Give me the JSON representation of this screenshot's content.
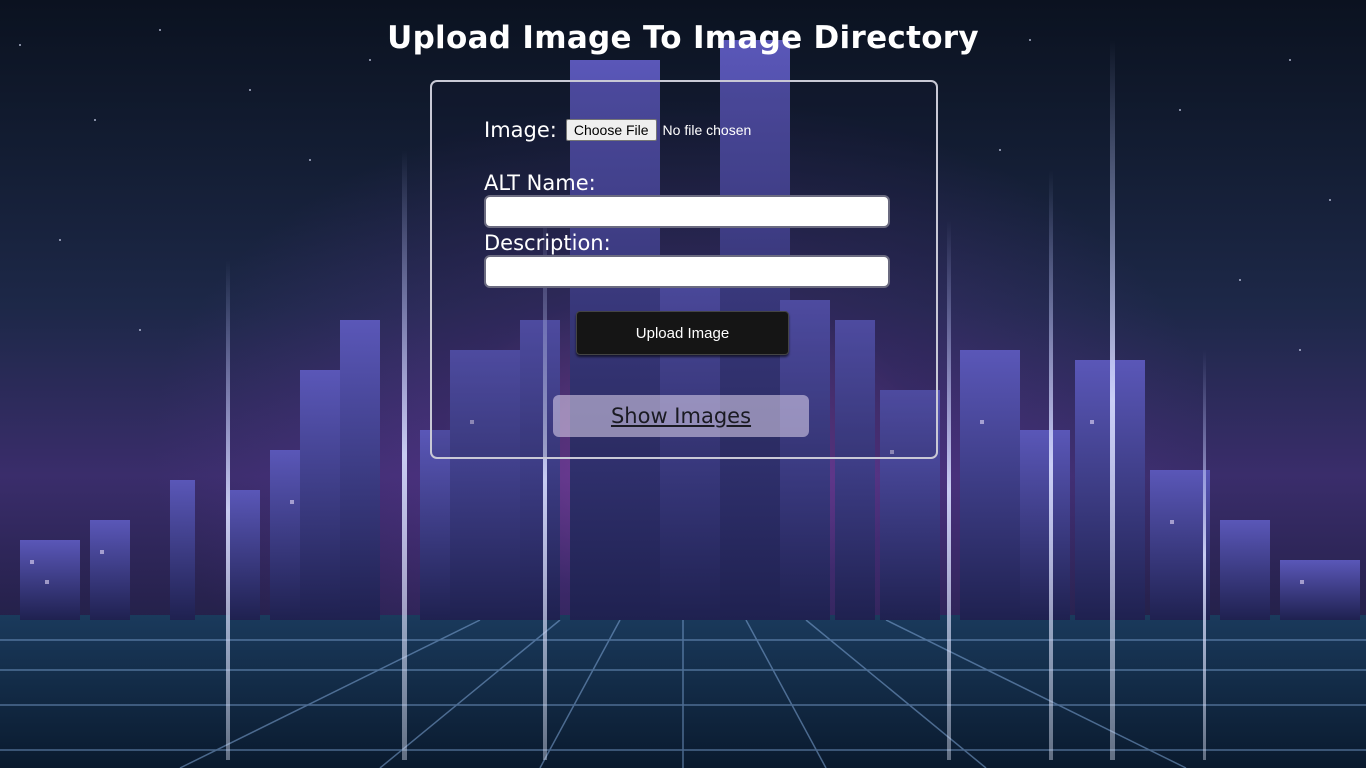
{
  "page": {
    "title": "Upload Image To Image Directory"
  },
  "form": {
    "image_label": "Image:",
    "file_button_label": "Choose File",
    "file_status": "No file chosen",
    "alt_label": "ALT Name:",
    "alt_value": "",
    "description_label": "Description:",
    "description_value": "",
    "submit_label": "Upload Image"
  },
  "nav": {
    "show_images_label": "Show Images"
  },
  "colors": {
    "title_text": "#ffffff",
    "panel_border": "#c9c9d6",
    "submit_background": "#151515",
    "link_background": "#e1d7f0"
  }
}
